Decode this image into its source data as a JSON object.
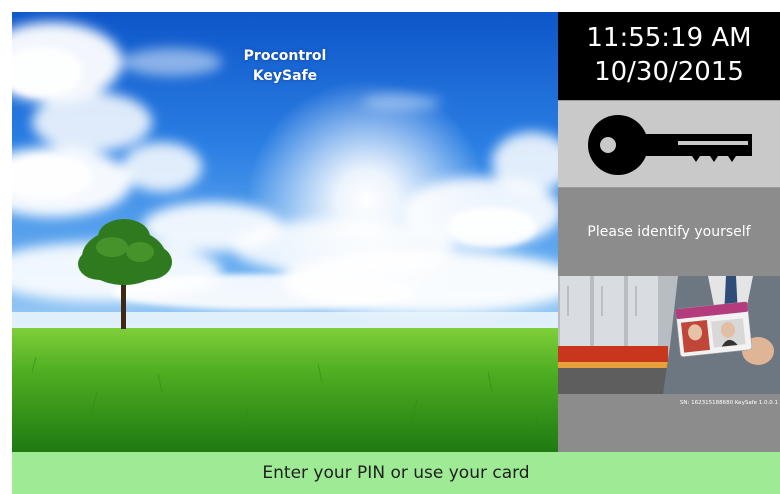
{
  "app": {
    "brand_line1": "Procontrol",
    "brand_line2": "KeySafe"
  },
  "clock": {
    "time": "11:55:19 AM",
    "date": "10/30/2015"
  },
  "sidebar": {
    "key_icon": "key-icon",
    "prompt": "Please identify yourself",
    "serial": "SN: 162315188680 KeySafe 1.0.0.1"
  },
  "footer": {
    "instruction": "Enter your PIN or use your card"
  },
  "colors": {
    "clock_bg": "#000000",
    "key_panel_bg": "#c9c9c9",
    "sidebar_bg": "#8c8c8c",
    "footer_bg": "#9eea95"
  }
}
